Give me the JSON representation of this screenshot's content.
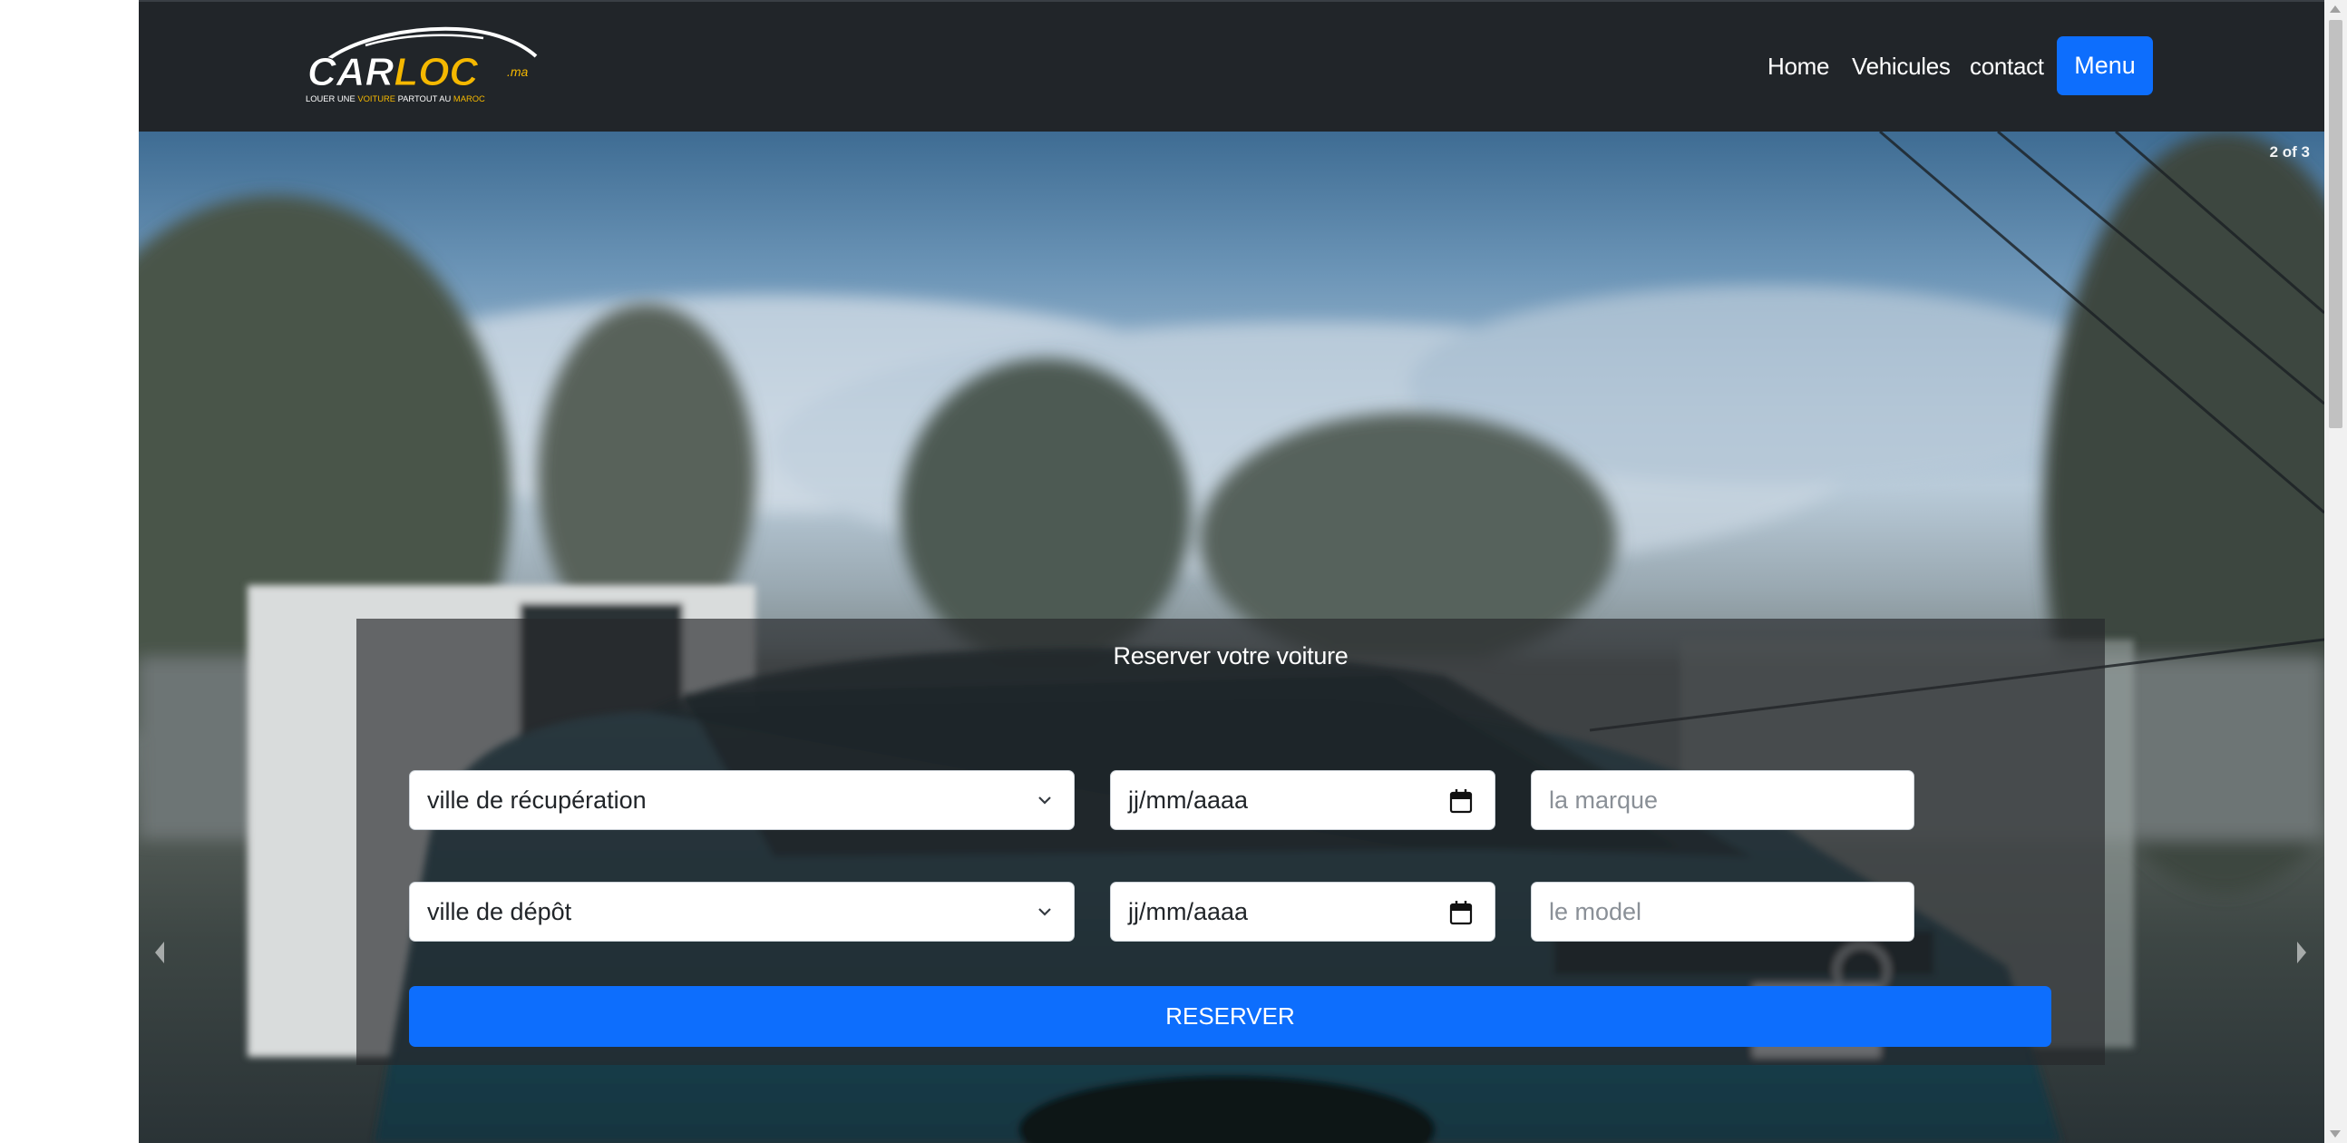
{
  "brand": {
    "logo_text_car": "CAR",
    "logo_text_loc": "LOC",
    "logo_text_ma": ".ma",
    "tagline_parts": [
      "LOUER UNE ",
      "VOITURE",
      " PARTOUT AU ",
      "MAROC"
    ],
    "colors": {
      "white": "#ffffff",
      "accent": "#f5b800"
    }
  },
  "nav": {
    "links": [
      "Home",
      "Vehicules",
      "contact"
    ],
    "menu_button": "Menu"
  },
  "carousel": {
    "counter": "2 of 3",
    "prev_icon": "chevron-left-icon",
    "next_icon": "chevron-right-icon"
  },
  "reservation": {
    "title": "Reserver votre voiture",
    "pickup_city": "ville de récupération",
    "pickup_date": "jj/mm/aaaa",
    "brand_placeholder": "la marque",
    "drop_city": "ville de dépôt",
    "drop_date": "jj/mm/aaaa",
    "model_placeholder": "le model",
    "submit": "RESERVER"
  },
  "colors": {
    "navbar_bg": "#212529",
    "primary": "#0d6efd"
  }
}
